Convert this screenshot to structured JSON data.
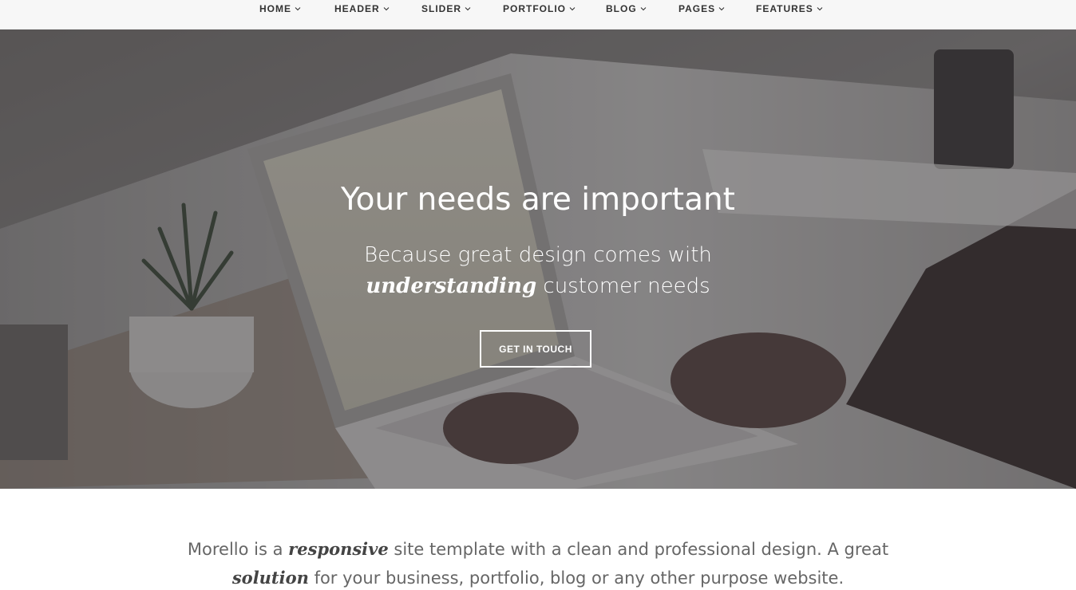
{
  "nav": {
    "items": [
      {
        "label": "HOME"
      },
      {
        "label": "HEADER"
      },
      {
        "label": "SLIDER"
      },
      {
        "label": "PORTFOLIO"
      },
      {
        "label": "BLOG"
      },
      {
        "label": "PAGES"
      },
      {
        "label": "FEATURES"
      }
    ],
    "chevron_icon": "chevron-down-icon"
  },
  "hero": {
    "title": "Your needs are important",
    "subtitle_part1": "Because great design comes with",
    "subtitle_emphasis": "understanding",
    "subtitle_part2": " customer needs",
    "cta_label": "GET IN TOUCH",
    "image_description_icon": "laptop-desk-photo"
  },
  "intro": {
    "part1": "Morello is a ",
    "emphasis1": "responsive",
    "part2": " site template with a clean and professional design. A great",
    "emphasis2": "solution",
    "part3": " for your business, portfolio, blog or any other purpose website."
  },
  "colors": {
    "nav_bg": "#f7f7f7",
    "hero_overlay": "#282830",
    "text_white": "#ffffff",
    "body_text": "#666666"
  }
}
